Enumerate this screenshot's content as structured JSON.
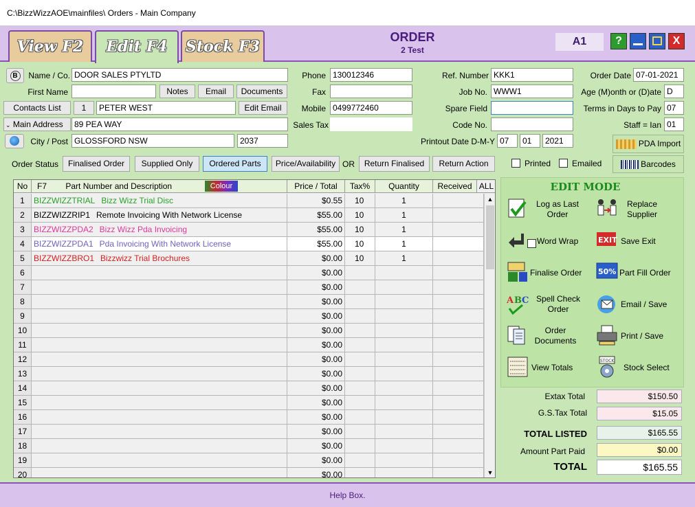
{
  "window": {
    "title": "C:\\BizzWizzAOE\\mainfiles\\ Orders - Main Company"
  },
  "header": {
    "tabs": [
      "View F2",
      "Edit F4",
      "Stock F3"
    ],
    "order_title": "ORDER",
    "order_sub": "2 Test",
    "user": "A1",
    "buttons": {
      "help": "?",
      "minimize": "",
      "maximize": "",
      "close": "X"
    }
  },
  "customer": {
    "name_label": "Name / Co.",
    "name": "DOOR SALES PTYLTD",
    "first_name_label": "First Name",
    "first_name": "",
    "notes": "Notes",
    "email": "Email",
    "documents": "Documents",
    "contacts_list": "Contacts List",
    "contact_no": "1",
    "contact_name": "PETER WEST",
    "edit_email": "Edit Email",
    "main_address_label": "Main Address",
    "main_address": "89 PEA WAY",
    "city_label": "City / Post",
    "city": "GLOSSFORD NSW",
    "post": "2037"
  },
  "contact": {
    "phone_label": "Phone",
    "phone": "130012346",
    "fax_label": "Fax",
    "fax": "",
    "mobile_label": "Mobile",
    "mobile": "0499772460",
    "sales_tax_label": "Sales Tax",
    "sales_tax": ""
  },
  "reference": {
    "ref_label": "Ref. Number",
    "ref": "KKK1",
    "job_label": "Job No.",
    "job": "WWW1",
    "spare_label": "Spare Field",
    "spare": "",
    "code_label": "Code No.",
    "code": "",
    "printout_label": "Printout Date D-M-Y",
    "d": "07",
    "m": "01",
    "y": "2021"
  },
  "order_info": {
    "date_label": "Order Date",
    "date": "07-01-2021",
    "age_label": "Age (M)onth or (D)ate",
    "age": "D",
    "terms_label": "Terms in Days to Pay",
    "terms": "07",
    "staff_label": "Staff = Ian",
    "staff": "01",
    "pda_import": "PDA Import",
    "barcodes": "Barcodes"
  },
  "status": {
    "label": "Order Status",
    "buttons": [
      "Finalised Order",
      "Supplied Only",
      "Ordered Parts",
      "Price/Availability"
    ],
    "or": "OR",
    "return_buttons": [
      "Return Finalised",
      "Return Action"
    ],
    "printed": "Printed",
    "emailed": "Emailed"
  },
  "grid": {
    "headers": {
      "no": "No",
      "f7": "F7",
      "part": "Part Number and Description",
      "colour": "Colour",
      "price": "Price / Total",
      "tax": "Tax%",
      "qty": "Quantity",
      "received": "Received",
      "all": "ALL"
    },
    "rows": [
      {
        "no": "1",
        "part": "BIZZWIZZTRIAL",
        "desc": "Bizz Wizz Trial Disc",
        "price": "$0.55",
        "tax": "10",
        "qty": "1",
        "color": "#2aa02a"
      },
      {
        "no": "2",
        "part": "BIZZWIZZRIP1",
        "desc": "Remote Invoicing With Network License",
        "price": "$55.00",
        "tax": "10",
        "qty": "1",
        "color": "#000000"
      },
      {
        "no": "3",
        "part": "BIZZWIZZPDA2",
        "desc": "Bizz Wizz Pda Invoicing",
        "price": "$55.00",
        "tax": "10",
        "qty": "1",
        "color": "#e0389a"
      },
      {
        "no": "4",
        "part": "BIZZWIZZPDA1",
        "desc": "Pda Invoicing With Network License",
        "price": "$55.00",
        "tax": "10",
        "qty": "1",
        "color": "#6f63c4"
      },
      {
        "no": "5",
        "part": "BIZZWIZZBRO1",
        "desc": "Bizzwizz Trial Brochures",
        "price": "$0.00",
        "tax": "10",
        "qty": "1",
        "color": "#d81f1f"
      },
      {
        "no": "6",
        "part": "",
        "desc": "",
        "price": "$0.00",
        "tax": "",
        "qty": "",
        "color": "#000000"
      },
      {
        "no": "7",
        "part": "",
        "desc": "",
        "price": "$0.00",
        "tax": "",
        "qty": "",
        "color": "#000000"
      },
      {
        "no": "8",
        "part": "",
        "desc": "",
        "price": "$0.00",
        "tax": "",
        "qty": "",
        "color": "#000000"
      },
      {
        "no": "9",
        "part": "",
        "desc": "",
        "price": "$0.00",
        "tax": "",
        "qty": "",
        "color": "#000000"
      },
      {
        "no": "10",
        "part": "",
        "desc": "",
        "price": "$0.00",
        "tax": "",
        "qty": "",
        "color": "#000000"
      },
      {
        "no": "11",
        "part": "",
        "desc": "",
        "price": "$0.00",
        "tax": "",
        "qty": "",
        "color": "#000000"
      },
      {
        "no": "12",
        "part": "",
        "desc": "",
        "price": "$0.00",
        "tax": "",
        "qty": "",
        "color": "#000000"
      },
      {
        "no": "13",
        "part": "",
        "desc": "",
        "price": "$0.00",
        "tax": "",
        "qty": "",
        "color": "#000000"
      },
      {
        "no": "14",
        "part": "",
        "desc": "",
        "price": "$0.00",
        "tax": "",
        "qty": "",
        "color": "#000000"
      },
      {
        "no": "15",
        "part": "",
        "desc": "",
        "price": "$0.00",
        "tax": "",
        "qty": "",
        "color": "#000000"
      },
      {
        "no": "16",
        "part": "",
        "desc": "",
        "price": "$0.00",
        "tax": "",
        "qty": "",
        "color": "#000000"
      },
      {
        "no": "17",
        "part": "",
        "desc": "",
        "price": "$0.00",
        "tax": "",
        "qty": "",
        "color": "#000000"
      },
      {
        "no": "18",
        "part": "",
        "desc": "",
        "price": "$0.00",
        "tax": "",
        "qty": "",
        "color": "#000000"
      },
      {
        "no": "19",
        "part": "",
        "desc": "",
        "price": "$0.00",
        "tax": "",
        "qty": "",
        "color": "#000000"
      },
      {
        "no": "20",
        "part": "",
        "desc": "",
        "price": "$0.00",
        "tax": "",
        "qty": "",
        "color": "#000000"
      }
    ]
  },
  "edit_mode": {
    "title": "EDIT MODE",
    "log_last": "Log as Last Order",
    "replace_supplier": "Replace Supplier",
    "word_wrap": "Word Wrap",
    "save_exit": "Save Exit",
    "finalise": "Finalise Order",
    "part_fill": "Part Fill Order",
    "part_fill_badge": "50%",
    "spell_check": "Spell Check Order",
    "email_save": "Email / Save",
    "order_docs": "Order Documents",
    "print_save": "Print / Save",
    "view_totals": "View Totals",
    "stock_select": "Stock Select"
  },
  "totals": {
    "extax_label": "Extax Total",
    "extax": "$150.50",
    "gst_label": "G.S.Tax Total",
    "gst": "$15.05",
    "listed_label": "TOTAL LISTED",
    "listed": "$165.55",
    "paid_label": "Amount Part Paid",
    "paid": "$0.00",
    "total_label": "TOTAL",
    "total": "$165.55"
  },
  "help": {
    "text": "Help Box."
  }
}
